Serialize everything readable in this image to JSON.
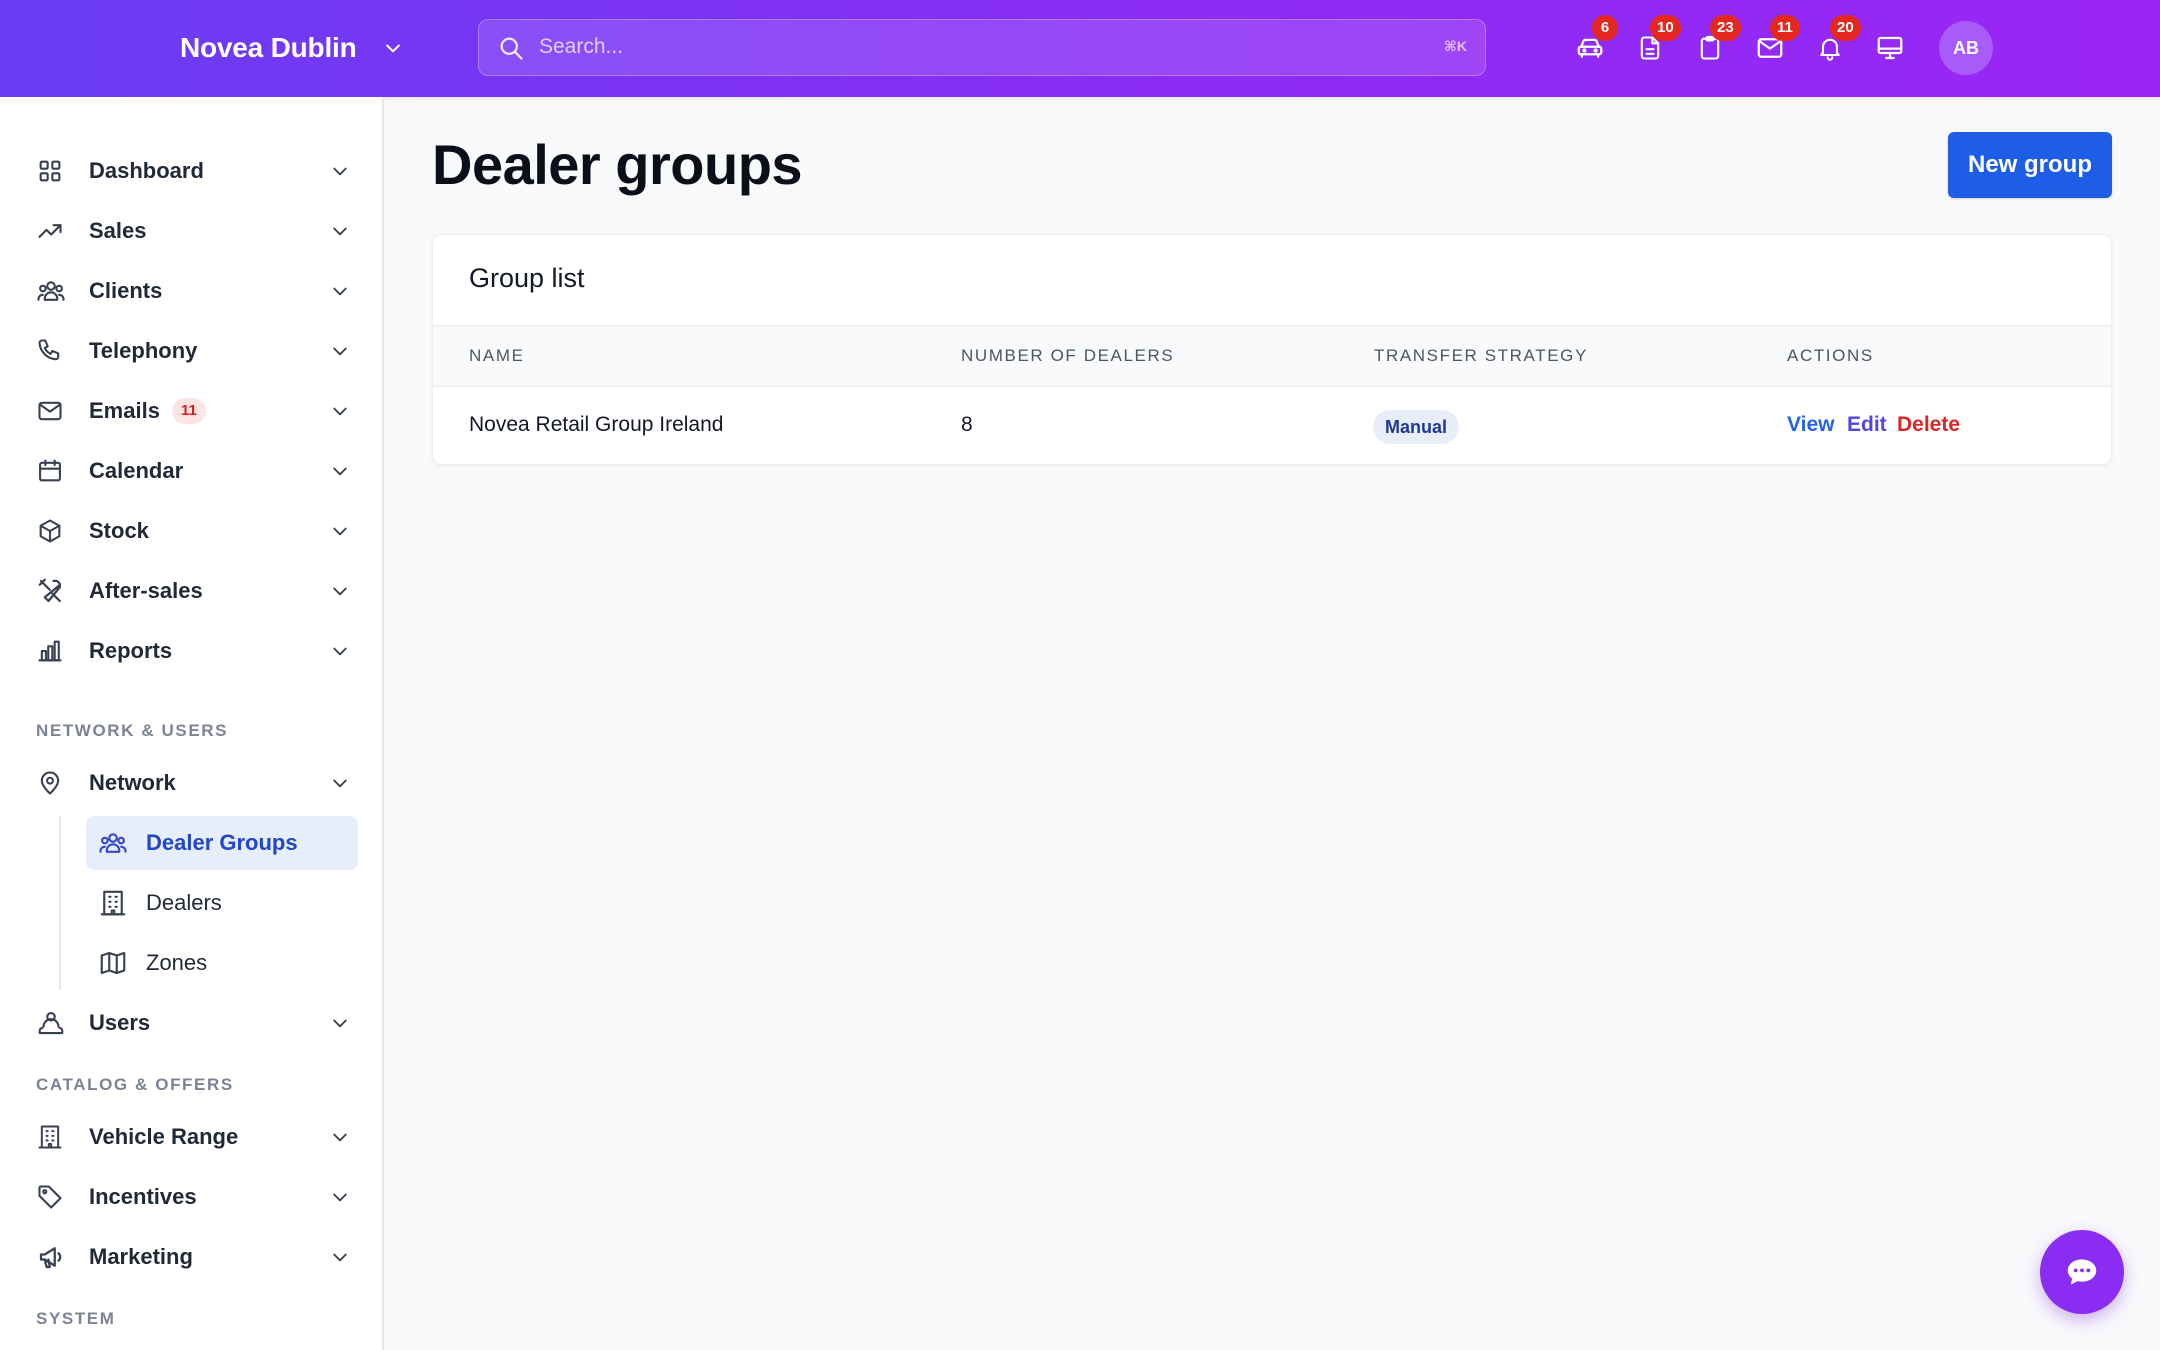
{
  "header": {
    "brand": "Novea Dublin",
    "search_placeholder": "Search...",
    "search_shortcut": "⌘K",
    "icons": [
      {
        "name": "car-icon",
        "badge": "6"
      },
      {
        "name": "document-icon",
        "badge": "10"
      },
      {
        "name": "clipboard-icon",
        "badge": "23"
      },
      {
        "name": "mail-icon",
        "badge": "11"
      },
      {
        "name": "bell-icon",
        "badge": "20"
      },
      {
        "name": "monitor-icon",
        "badge": ""
      }
    ],
    "avatar_initials": "AB"
  },
  "sidebar": {
    "items": [
      {
        "label": "Dashboard",
        "icon": "grid-icon"
      },
      {
        "label": "Sales",
        "icon": "trending-up-icon"
      },
      {
        "label": "Clients",
        "icon": "users-icon"
      },
      {
        "label": "Telephony",
        "icon": "phone-icon"
      },
      {
        "label": "Emails",
        "icon": "mail-icon",
        "badge": "11"
      },
      {
        "label": "Calendar",
        "icon": "calendar-icon"
      },
      {
        "label": "Stock",
        "icon": "cube-icon"
      },
      {
        "label": "After-sales",
        "icon": "tools-icon"
      },
      {
        "label": "Reports",
        "icon": "chart-bars-icon"
      }
    ],
    "section_network": "NETWORK & USERS",
    "network": {
      "label": "Network",
      "icon": "map-pin-icon"
    },
    "network_children": [
      {
        "label": "Dealer Groups",
        "icon": "users-icon",
        "active": true
      },
      {
        "label": "Dealers",
        "icon": "building-icon"
      },
      {
        "label": "Zones",
        "icon": "map-icon"
      }
    ],
    "users": {
      "label": "Users",
      "icon": "user-group-icon"
    },
    "section_catalog": "CATALOG & OFFERS",
    "catalog": [
      {
        "label": "Vehicle Range",
        "icon": "building-icon"
      },
      {
        "label": "Incentives",
        "icon": "tag-icon"
      },
      {
        "label": "Marketing",
        "icon": "megaphone-icon"
      }
    ],
    "section_system": "SYSTEM"
  },
  "main": {
    "title": "Dealer groups",
    "new_button": "New group",
    "card_title": "Group list",
    "columns": [
      "NAME",
      "NUMBER OF DEALERS",
      "TRANSFER STRATEGY",
      "ACTIONS"
    ],
    "rows": [
      {
        "name": "Novea Retail Group Ireland",
        "dealers": "8",
        "strategy": "Manual",
        "actions": {
          "view": "View",
          "edit": "Edit",
          "delete": "Delete"
        }
      }
    ]
  },
  "colors": {
    "header_gradient_start": "#6a3cf4",
    "header_gradient_end": "#9a26f4",
    "primary_button": "#1e5ee6",
    "active_nav_bg": "#e6edfb",
    "badge_red": "#e5281f",
    "view_link": "#2563eb",
    "edit_link": "#4f46e5",
    "delete_link": "#dc2626"
  }
}
